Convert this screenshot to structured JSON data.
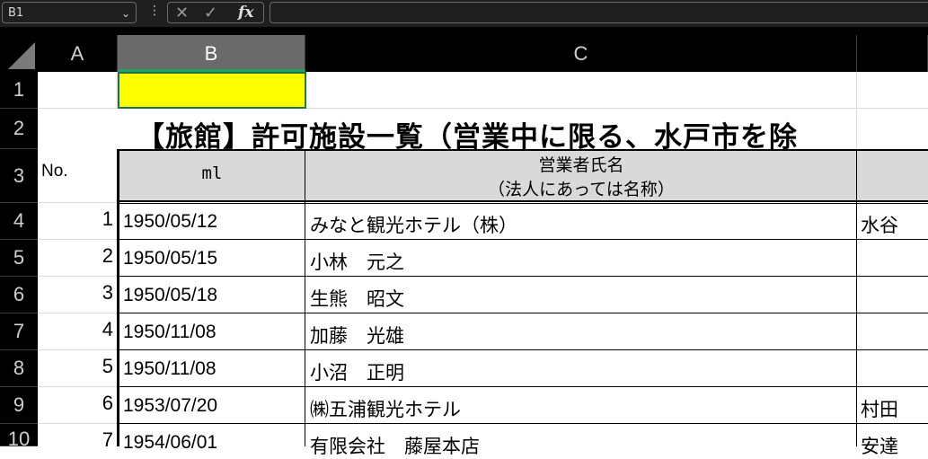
{
  "formula_bar": {
    "name_box": "B1",
    "cancel_icon": "✕",
    "enter_icon": "✓",
    "fx_label": "fx",
    "formula": ""
  },
  "columns": [
    "A",
    "B",
    "C"
  ],
  "rows": [
    "1",
    "2",
    "3",
    "4",
    "5",
    "6",
    "7",
    "8",
    "9",
    "10"
  ],
  "sheet": {
    "title": "【旅館】許可施設一覧（営業中に限る、水戸市を除",
    "header_no": "No.",
    "header_b": "ml",
    "header_c_line1": "営業者氏名",
    "header_c_line2": "（法人にあっては名称）",
    "records": [
      {
        "no": "1",
        "date": "1950/05/12",
        "name": "みなと観光ホテル（株）",
        "d": "水谷　"
      },
      {
        "no": "2",
        "date": "1950/05/15",
        "name": "小林　元之",
        "d": ""
      },
      {
        "no": "3",
        "date": "1950/05/18",
        "name": "生熊　昭文",
        "d": ""
      },
      {
        "no": "4",
        "date": "1950/11/08",
        "name": "加藤　光雄",
        "d": ""
      },
      {
        "no": "5",
        "date": "1950/11/08",
        "name": "小沼　正明",
        "d": ""
      },
      {
        "no": "6",
        "date": "1953/07/20",
        "name": "㈱五浦観光ホテル",
        "d": "村田　"
      },
      {
        "no": "7",
        "date": "1954/06/01",
        "name": "有限会社　藤屋本店",
        "d": "安達"
      }
    ]
  },
  "colors": {
    "selected_fill": "#ffff00",
    "selection_border": "#1e7145",
    "header_fill": "#d9d9d9"
  }
}
